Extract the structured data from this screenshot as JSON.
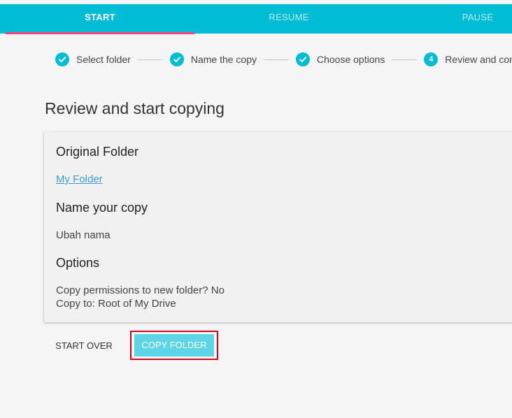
{
  "tabs": {
    "start": "START",
    "resume": "RESUME",
    "pause": "PAUSE",
    "active": "start"
  },
  "stepper": {
    "steps": [
      {
        "label": "Select folder",
        "state": "complete"
      },
      {
        "label": "Name the copy",
        "state": "complete"
      },
      {
        "label": "Choose options",
        "state": "complete"
      },
      {
        "label": "Review and confirm",
        "state": "active",
        "number": "4"
      }
    ]
  },
  "page": {
    "title": "Review and start copying"
  },
  "summary": {
    "original_heading": "Original Folder",
    "original_link": "My Folder",
    "name_heading": "Name your copy",
    "name_value": "Ubah nama",
    "options_heading": "Options",
    "option_permissions": "Copy permissions to new folder? No",
    "option_destination": "Copy to: Root of My Drive"
  },
  "actions": {
    "start_over": "START OVER",
    "copy_folder": "COPY FOLDER"
  },
  "colors": {
    "primary": "#00bcd4",
    "accent": "#ff4081",
    "button": "#5cd6e6",
    "link": "#3f9bd8",
    "highlight": "#d0021b"
  },
  "icons": {
    "step_complete": "checkmark-icon"
  }
}
